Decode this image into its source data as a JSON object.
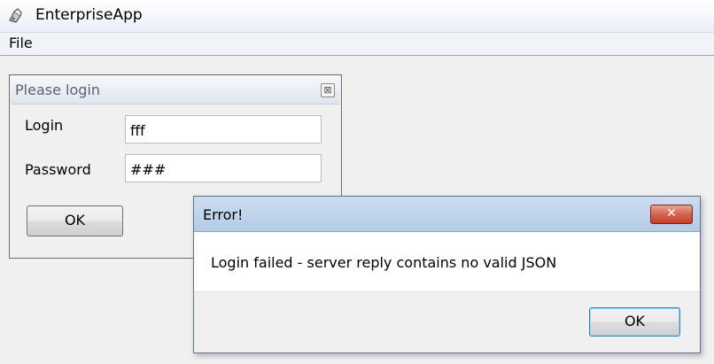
{
  "window": {
    "title": "EnterpriseApp",
    "icon": "app-icon"
  },
  "menu": {
    "items": [
      {
        "label": "File"
      }
    ]
  },
  "login_frame": {
    "title": "Please login",
    "login_label": "Login",
    "login_value": "fff",
    "password_label": "Password",
    "password_value": "###",
    "ok_label": "OK",
    "close_icon": "close-icon"
  },
  "error_dialog": {
    "title": "Error!",
    "message": "Login failed - server reply contains no valid JSON",
    "ok_label": "OK",
    "close_icon": "close-icon",
    "close_color": "#c9442f"
  }
}
